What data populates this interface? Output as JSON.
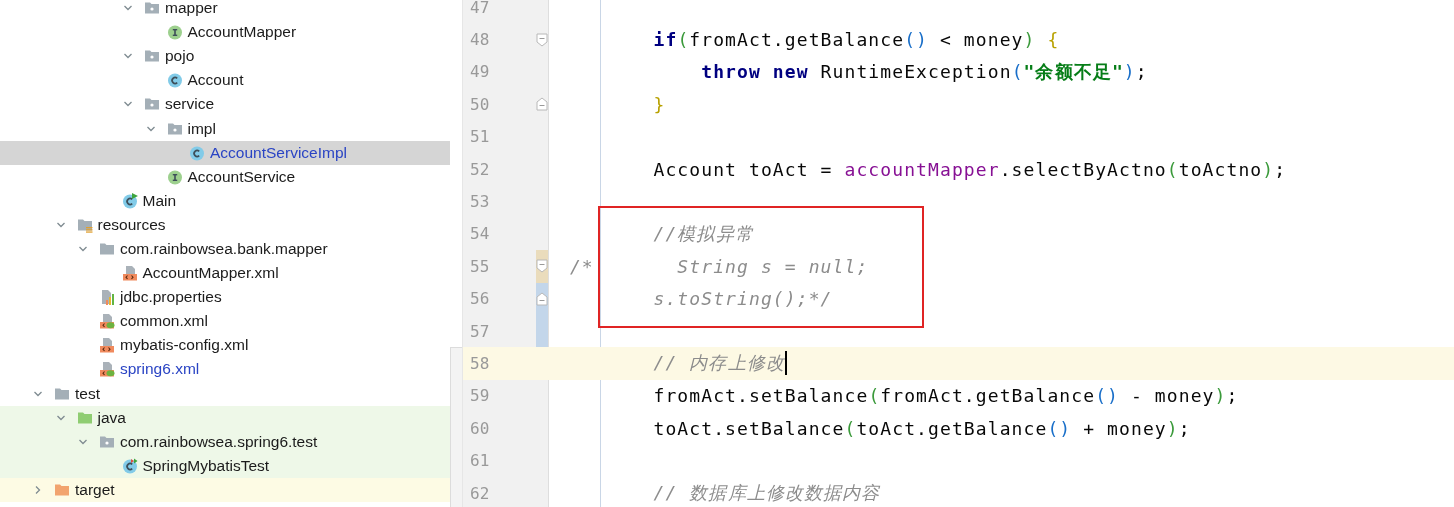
{
  "tree": {
    "nodes": [
      {
        "children": [
          {
            "children": [
              {
                "children": [
                  {
                    "children": [
                      {
                        "label": "mapper",
                        "kind": "package",
                        "expanded": true,
                        "selected": false,
                        "children": [
                          {
                            "label": "AccountMapper",
                            "kind": "interface",
                            "selected": false
                          }
                        ]
                      },
                      {
                        "label": "pojo",
                        "kind": "package",
                        "expanded": true,
                        "selected": false,
                        "children": [
                          {
                            "label": "Account",
                            "kind": "class",
                            "selected": false
                          }
                        ]
                      },
                      {
                        "label": "service",
                        "kind": "package",
                        "expanded": true,
                        "selected": false,
                        "children": [
                          {
                            "label": "impl",
                            "kind": "package",
                            "expanded": true,
                            "selected": false,
                            "children": [
                              {
                                "label": "AccountServiceImpl",
                                "kind": "class",
                                "selected": true,
                                "modified": true
                              }
                            ]
                          },
                          {
                            "label": "AccountService",
                            "kind": "interface",
                            "selected": false
                          }
                        ]
                      }
                    ]
                  },
                  {
                    "label": "Main",
                    "kind": "main-class",
                    "selected": false
                  }
                ]
              }
            ]
          },
          {
            "label": "resources",
            "kind": "resources",
            "expanded": true,
            "selected": false,
            "children": [
              {
                "label": "com.rainbowsea.bank.mapper",
                "kind": "folder",
                "expanded": true,
                "selected": false,
                "children": [
                  {
                    "label": "AccountMapper.xml",
                    "kind": "xml",
                    "selected": false
                  }
                ]
              },
              {
                "label": "jdbc.properties",
                "kind": "properties",
                "selected": false
              },
              {
                "label": "common.xml",
                "kind": "spring-xml",
                "selected": false
              },
              {
                "label": "mybatis-config.xml",
                "kind": "xml",
                "selected": false
              },
              {
                "label": "spring6.xml",
                "kind": "spring-xml",
                "selected": false,
                "modified": true
              }
            ]
          }
        ]
      },
      {
        "label": "test",
        "kind": "folder",
        "expanded": true,
        "selected": false,
        "children": [
          {
            "label": "java",
            "kind": "test-source",
            "expanded": true,
            "selected": false,
            "test_root": true,
            "children": [
              {
                "label": "com.rainbowsea.spring6.test",
                "kind": "package",
                "expanded": true,
                "selected": false,
                "children": [
                  {
                    "label": "SpringMybatisTest",
                    "kind": "test-class",
                    "selected": false
                  }
                ]
              }
            ]
          }
        ]
      },
      {
        "label": "target",
        "kind": "excluded",
        "expanded": false,
        "selected": false,
        "excluded": true
      }
    ]
  },
  "editor": {
    "annotation": {
      "kind": "rectangle"
    },
    "lines": [
      {
        "number": "47"
      },
      {
        "number": "48",
        "fold_start": true,
        "tokens": [
          {
            "t": "        if",
            "kind": "keyword"
          },
          {
            "t": "(",
            "kind": "paren"
          },
          {
            "t": "fromAct.getBalance"
          },
          {
            "t": "()",
            "kind": "call"
          },
          {
            "t": " < money"
          },
          {
            "t": ")",
            "kind": "paren"
          },
          {
            "t": " {",
            "kind": "brace"
          }
        ]
      },
      {
        "number": "49",
        "tokens": [
          {
            "t": "            throw",
            "kind": "keyword"
          },
          {
            "t": " new",
            "kind": "keyword"
          },
          {
            "t": " RuntimeException"
          },
          {
            "t": "(",
            "kind": "call"
          },
          {
            "t": "\"余额不足\"",
            "kind": "string"
          },
          {
            "t": ")",
            "kind": "call"
          },
          {
            "t": ";"
          }
        ]
      },
      {
        "number": "50",
        "fold_end": true,
        "tokens": [
          {
            "t": "        }",
            "kind": "brace"
          }
        ]
      },
      {
        "number": "51"
      },
      {
        "number": "52",
        "tokens": [
          {
            "t": "        Account toAct = "
          },
          {
            "t": "accountMapper",
            "kind": "field"
          },
          {
            "t": ".selectByActno"
          },
          {
            "t": "(",
            "kind": "paren"
          },
          {
            "t": "toActno"
          },
          {
            "t": ")",
            "kind": "paren"
          },
          {
            "t": ";"
          }
        ]
      },
      {
        "number": "53"
      },
      {
        "number": "54",
        "tokens": [
          {
            "t": "        //模拟异常",
            "kind": "comment"
          }
        ]
      },
      {
        "number": "55",
        "fold_start": true,
        "changed": true,
        "tokens": [
          {
            "t": " /*       String s = null;",
            "kind": "comment"
          }
        ]
      },
      {
        "number": "56",
        "fold_end": true,
        "modified": true,
        "tokens": [
          {
            "t": "        s.toString();*/",
            "kind": "comment"
          }
        ]
      },
      {
        "number": "57",
        "modified": true
      },
      {
        "number": "58",
        "current": true,
        "tokens": [
          {
            "t": "        // 内存上修改",
            "kind": "comment"
          }
        ]
      },
      {
        "number": "59",
        "tokens": [
          {
            "t": "        fromAct.setBalance"
          },
          {
            "t": "(",
            "kind": "paren"
          },
          {
            "t": "fromAct.getBalance"
          },
          {
            "t": "()",
            "kind": "call"
          },
          {
            "t": " - money"
          },
          {
            "t": ")",
            "kind": "paren"
          },
          {
            "t": ";"
          }
        ]
      },
      {
        "number": "60",
        "tokens": [
          {
            "t": "        toAct.setBalance"
          },
          {
            "t": "(",
            "kind": "paren"
          },
          {
            "t": "toAct.getBalance"
          },
          {
            "t": "()",
            "kind": "call"
          },
          {
            "t": " + money"
          },
          {
            "t": ")",
            "kind": "paren"
          },
          {
            "t": ";"
          }
        ]
      },
      {
        "number": "61"
      },
      {
        "number": "62",
        "tokens": [
          {
            "t": "        // 数据库上修改数据内容",
            "kind": "comment"
          }
        ]
      }
    ]
  }
}
